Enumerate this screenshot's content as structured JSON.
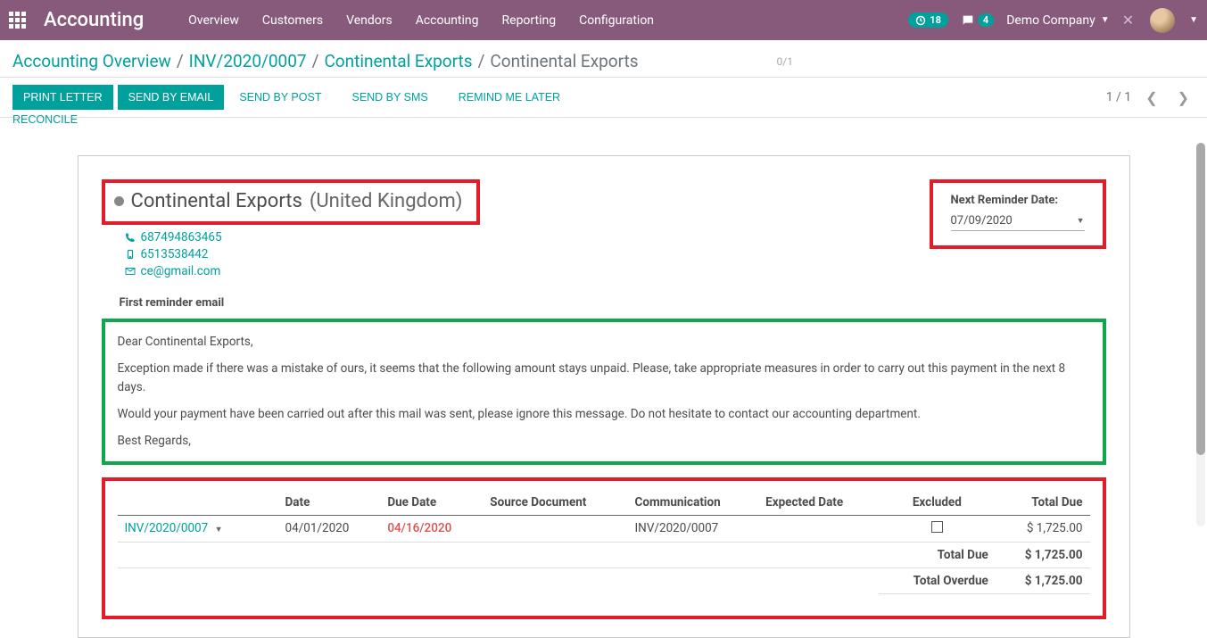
{
  "brand": "Accounting",
  "nav": {
    "items": [
      "Overview",
      "Customers",
      "Vendors",
      "Accounting",
      "Reporting",
      "Configuration"
    ]
  },
  "nav_right": {
    "clock_count": "18",
    "chat_count": "4",
    "company": "Demo Company"
  },
  "breadcrumbs": {
    "items": [
      "Accounting Overview",
      "INV/2020/0007",
      "Continental Exports",
      "Continental Exports"
    ],
    "right_hint": "0/1"
  },
  "actions": {
    "print_letter": "PRINT LETTER",
    "send_email": "SEND BY EMAIL",
    "send_post": "SEND BY POST",
    "send_sms": "SEND BY SMS",
    "remind_later": "REMIND ME LATER",
    "reconcile": "RECONCILE",
    "pager": "1 / 1"
  },
  "customer": {
    "name": "Continental Exports",
    "country": "(United Kingdom)",
    "phone": "687494863465",
    "mobile": "6513538442",
    "email": "ce@gmail.com"
  },
  "reminder": {
    "label": "Next Reminder Date:",
    "date": "07/09/2020"
  },
  "email": {
    "title": "First reminder email",
    "greeting": "Dear Continental Exports,",
    "body1": "Exception made if there was a mistake of ours, it seems that the following amount stays unpaid. Please, take appropriate measures in order to carry out this payment in the next 8 days.",
    "body2": "Would your payment have been carried out after this mail was sent, please ignore this message. Do not hesitate to contact our accounting department.",
    "signoff": "Best Regards,"
  },
  "table": {
    "headers": {
      "invoice": "",
      "date": "Date",
      "due_date": "Due Date",
      "source": "Source Document",
      "communication": "Communication",
      "expected": "Expected Date",
      "excluded": "Excluded",
      "total_due": "Total Due"
    },
    "rows": [
      {
        "invoice": "INV/2020/0007",
        "date": "04/01/2020",
        "due_date": "04/16/2020",
        "source": "",
        "communication": "INV/2020/0007",
        "expected": "",
        "excluded": false,
        "total_due": "$ 1,725.00"
      }
    ],
    "totals": {
      "total_due_label": "Total Due",
      "total_due_value": "$ 1,725.00",
      "total_overdue_label": "Total Overdue",
      "total_overdue_value": "$ 1,725.00"
    }
  }
}
